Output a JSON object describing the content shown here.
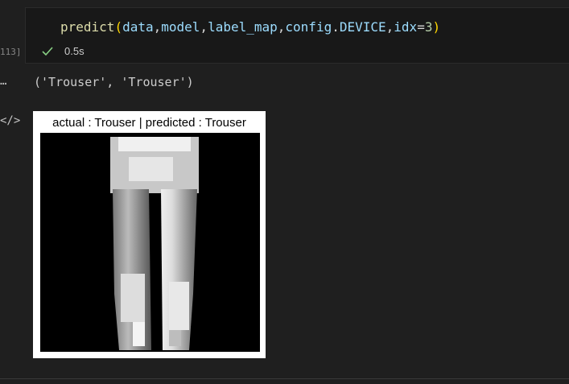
{
  "cell": {
    "exec_count": "113]",
    "code": {
      "fn": "predict",
      "open": "(",
      "args": [
        "data",
        "model",
        "label_map",
        "config",
        "DEVICE",
        "idx"
      ],
      "idx_value": "3",
      "close": ")"
    },
    "status": {
      "icon": "check-icon",
      "time": "0.5s"
    }
  },
  "output": {
    "more_icon": "…",
    "text": "('Trouser', 'Trouser')",
    "code_icon": "</>"
  },
  "figure": {
    "title": "actual : Trouser | predicted : Trouser"
  },
  "colors": {
    "background": "#1f1f1f",
    "cell_bg": "#181818",
    "check": "#89d185"
  }
}
